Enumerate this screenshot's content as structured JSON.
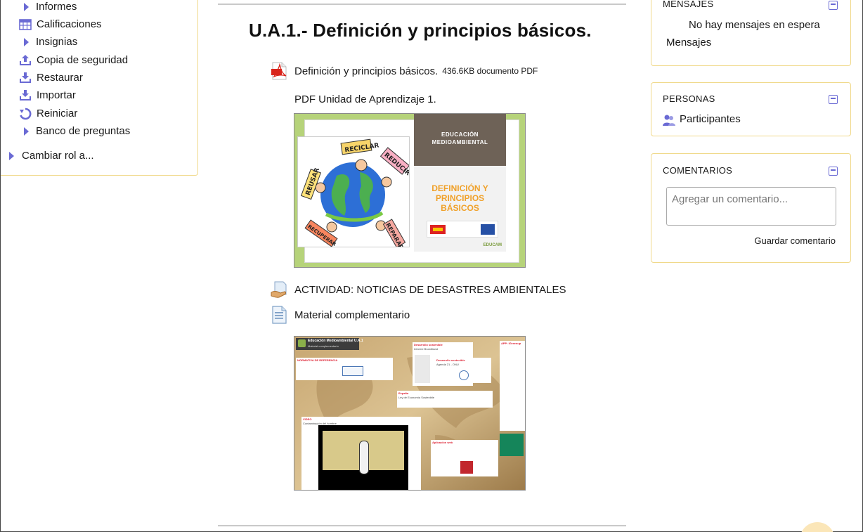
{
  "admin_nav": {
    "items": [
      {
        "label": "Informes",
        "icon": "chevron-right-icon"
      },
      {
        "label": "Calificaciones",
        "icon": "table-icon"
      },
      {
        "label": "Insignias",
        "icon": "chevron-right-icon"
      },
      {
        "label": "Copia de seguridad",
        "icon": "upload-icon"
      },
      {
        "label": "Restaurar",
        "icon": "download-icon"
      },
      {
        "label": "Importar",
        "icon": "download-icon"
      },
      {
        "label": "Reiniciar",
        "icon": "reset-icon"
      },
      {
        "label": "Banco de preguntas",
        "icon": "chevron-right-icon"
      },
      {
        "label": "Cambiar rol a...",
        "icon": "chevron-right-icon"
      }
    ]
  },
  "section": {
    "title": "U.A.1.- Definición y principios básicos.",
    "activities": [
      {
        "label": "Definición y principios básicos.",
        "meta": "436.6KB documento PDF",
        "icon": "pdf-icon"
      },
      {
        "label": "ACTIVIDAD: NOTICIAS DE DESASTRES AMBIENTALES",
        "icon": "assignment-icon"
      },
      {
        "label": "Material complementario",
        "icon": "page-icon"
      }
    ],
    "pdf_description": "PDF Unidad de Aprendizaje 1.",
    "cover": {
      "header": "EDUCACIÓN MEDIOAMBIENTAL",
      "title": "DEFINICIÓN Y PRINCIPIOS BÁSICOS",
      "footer": "EDUCAM",
      "signs": [
        "RECICLAR",
        "REDUCIR",
        "REUSAR",
        "REPARAR",
        "RECUPERAR"
      ]
    },
    "prezi": {
      "title": "Educación Medioambiental U.A.1",
      "subtitle": "Material complementario",
      "labels": [
        "NORMATIVA DE REFERENCIA",
        "Desarrollo sostenible",
        "Informe Brundtland",
        "Desarrollo sostenible",
        "Agenda 21 - ONU",
        "España",
        "Ley de Economía Sostenible",
        "VIDEO",
        "Contaminación del hombre",
        "Aplicación web",
        "APP: IGreenup"
      ]
    }
  },
  "blocks": {
    "messages": {
      "title": "MENSAJES",
      "empty_text": "No hay mensajes en espera",
      "link": "Mensajes"
    },
    "people": {
      "title": "PERSONAS",
      "link": "Participantes"
    },
    "comments": {
      "title": "COMENTARIOS",
      "placeholder": "Agregar un comentario...",
      "save_label": "Guardar comentario"
    }
  },
  "colors": {
    "accent": "#6a6ad4",
    "block_border": "#f0d98a",
    "orange": "#f0a12a"
  }
}
